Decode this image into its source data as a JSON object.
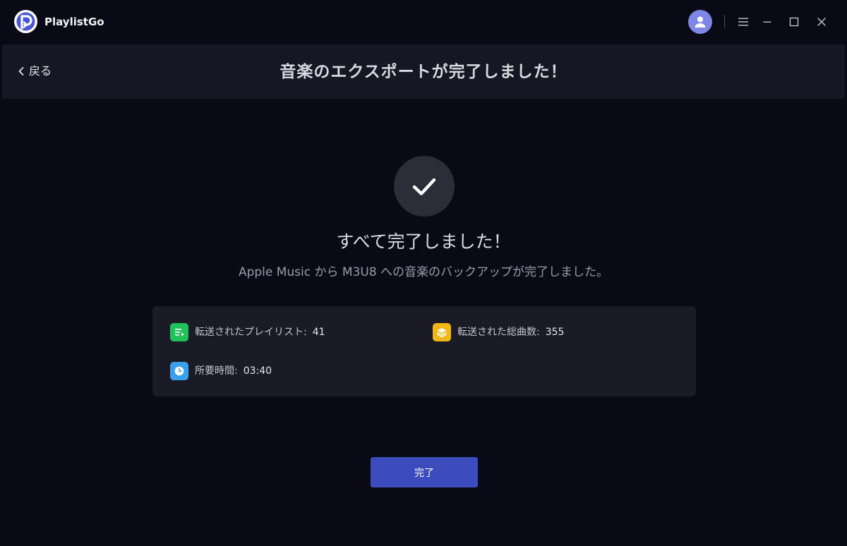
{
  "app": {
    "name": "PlaylistGo",
    "logo_icon": "playlistgo-logo-icon",
    "accent_color": "#3c4cbd"
  },
  "titlebar": {
    "avatar_icon": "user-avatar-icon",
    "menu_icon": "hamburger-menu-icon",
    "minimize_icon": "minimize-icon",
    "maximize_icon": "maximize-icon",
    "close_icon": "close-icon"
  },
  "header": {
    "back_label": "戻る",
    "title": "音楽のエクスポートが完了しました！"
  },
  "result": {
    "icon": "checkmark-icon",
    "title": "すべて完了しました！",
    "subtitle": "Apple Music から M3U8 への音楽のバックアップが完了しました。"
  },
  "stats": {
    "playlists": {
      "icon": "playlist-icon",
      "icon_color": "#22c05a",
      "label": "転送されたプレイリスト:",
      "value": "41"
    },
    "songs": {
      "icon": "layers-icon",
      "icon_color": "#f0b816",
      "label": "転送された総曲数:",
      "value": "355"
    },
    "duration": {
      "icon": "clock-icon",
      "icon_color": "#3aa0ea",
      "label": "所要時間:",
      "value": "03:40"
    }
  },
  "finish_button": {
    "label": "完了"
  }
}
